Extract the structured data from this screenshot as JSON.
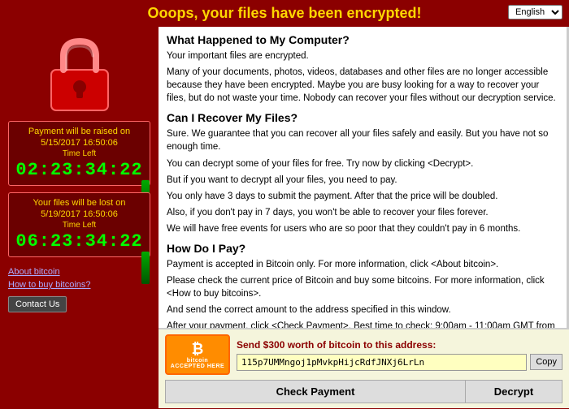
{
  "header": {
    "title": "Ooops, your files have been encrypted!",
    "lang_default": "English"
  },
  "left": {
    "payment_raise_label": "Payment will be raised on",
    "payment_raise_date": "5/15/2017 16:50:06",
    "time_left_label": "Time Left",
    "countdown1": "02:23:34:22",
    "files_lost_label": "Your files will be lost on",
    "files_lost_date": "5/19/2017 16:50:06",
    "countdown2": "06:23:34:22",
    "link_about_bitcoin": "About bitcoin",
    "link_how_to_buy": "How to buy bitcoins?",
    "contact_us": "Contact Us"
  },
  "content": {
    "section1_title": "What Happened to My Computer?",
    "section1_p1": "Your important files are encrypted.",
    "section1_p2": "Many of your documents, photos, videos, databases and other files are no longer accessible because they have been encrypted. Maybe you are busy looking for a way to recover your files, but do not waste your time. Nobody can recover your files without our decryption service.",
    "section2_title": "Can I Recover My Files?",
    "section2_p1": "Sure. We guarantee that you can recover all your files safely and easily. But you have not so enough time.",
    "section2_p2": "You can decrypt some of your files for free. Try now by clicking <Decrypt>.",
    "section2_p3": "But if you want to decrypt all your files, you need to pay.",
    "section2_p4": "You only have 3 days to submit the payment. After that the price will be doubled.",
    "section2_p5": "Also, if you don't pay in 7 days, you won't be able to recover your files forever.",
    "section2_p6": "We will have free events for users who are so poor that they couldn't pay in 6 months.",
    "section3_title": "How Do I Pay?",
    "section3_p1": "Payment is accepted in Bitcoin only. For more information, click <About bitcoin>.",
    "section3_p2": "Please check the current price of Bitcoin and buy some bitcoins. For more information, click <How to buy bitcoins>.",
    "section3_p3": "And send the correct amount to the address specified in this window.",
    "section3_p4": "After your payment, click <Check Payment>. Best time to check: 9:00am - 11:00am GMT from Monday to Friday."
  },
  "payment": {
    "bitcoin_text": "bitcoin",
    "accepted_text": "ACCEPTED HERE",
    "send_label": "Send $300 worth of bitcoin to this address:",
    "btc_address": "115p7UMMngoj1pMvkpHijcRdfJNXj6LrLn",
    "copy_label": "Copy",
    "check_payment_label": "Check Payment",
    "decrypt_label": "Decrypt"
  }
}
